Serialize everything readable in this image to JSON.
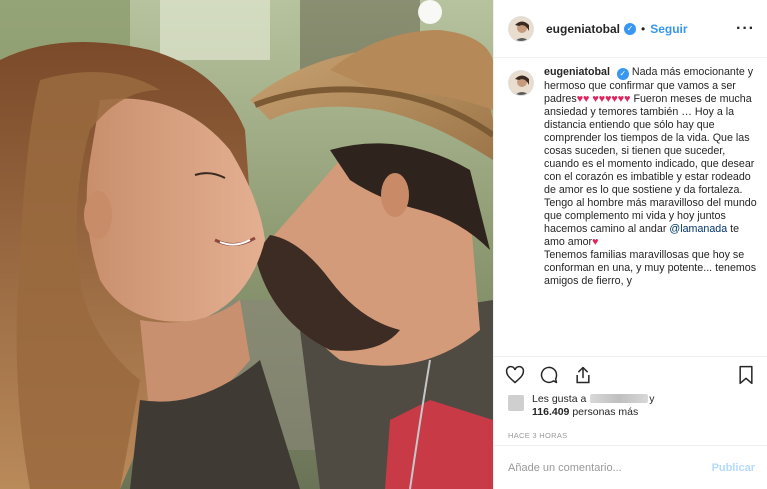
{
  "header": {
    "username": "eugeniatobal",
    "follow_label": "Seguir",
    "separator": "•",
    "more_label": "···"
  },
  "caption": {
    "username": "eugeniatobal",
    "part1": "Nada más emocionante y hermoso que confirmar que vamos a ser padres",
    "hearts_a": "♥♥",
    "hearts_b": "♥♥♥♥♥♥",
    "part2": "Fueron meses de mucha ansiedad y temores también … Hoy a la distancia entiendo que sólo hay que comprender los tiempos de la vida. Que las cosas suceden, si tienen que suceder, cuando es el momento indicado, que desear con el corazón es imbatible y estar rodeado de amor es lo que sostiene y da fortaleza. Tengo al hombre más maravilloso del mundo que complemento mi vida y hoy juntos hacemos camino al andar",
    "mention": "@lamanada",
    "part3": "te amo amor",
    "heart_c": "♥",
    "part4": "Tenemos familias maravillosas que hoy se conforman en una, y muy potente... tenemos amigos de fierro, y"
  },
  "actions": {
    "like_icon": "heart-icon",
    "comment_icon": "comment-icon",
    "share_icon": "share-icon",
    "save_icon": "bookmark-icon"
  },
  "likes": {
    "prefix": "Les gusta a",
    "suffix": "y",
    "count": "116.409",
    "count_suffix": "personas más"
  },
  "timestamp": "HACE 3 HORAS",
  "comment_box": {
    "placeholder": "Añade un comentario...",
    "publish_label": "Publicar"
  },
  "colors": {
    "accent": "#3897f0",
    "heart": "#e0245e",
    "publish_disabled": "#b3dbff"
  }
}
